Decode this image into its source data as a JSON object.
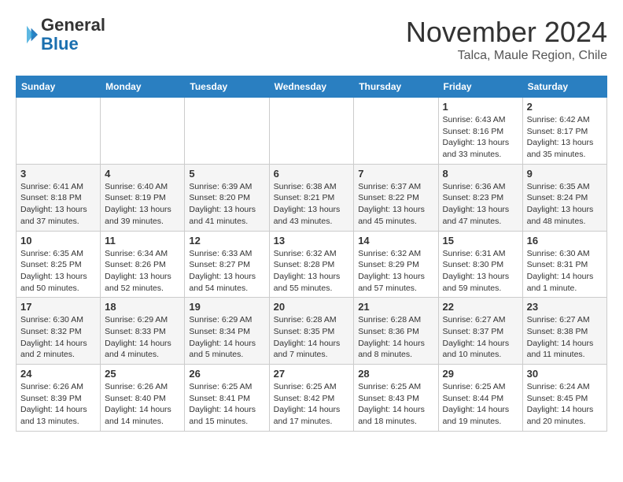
{
  "header": {
    "logo_general": "General",
    "logo_blue": "Blue",
    "month_title": "November 2024",
    "location": "Talca, Maule Region, Chile"
  },
  "weekdays": [
    "Sunday",
    "Monday",
    "Tuesday",
    "Wednesday",
    "Thursday",
    "Friday",
    "Saturday"
  ],
  "weeks": [
    [
      {
        "day": "",
        "info": ""
      },
      {
        "day": "",
        "info": ""
      },
      {
        "day": "",
        "info": ""
      },
      {
        "day": "",
        "info": ""
      },
      {
        "day": "",
        "info": ""
      },
      {
        "day": "1",
        "info": "Sunrise: 6:43 AM\nSunset: 8:16 PM\nDaylight: 13 hours and 33 minutes."
      },
      {
        "day": "2",
        "info": "Sunrise: 6:42 AM\nSunset: 8:17 PM\nDaylight: 13 hours and 35 minutes."
      }
    ],
    [
      {
        "day": "3",
        "info": "Sunrise: 6:41 AM\nSunset: 8:18 PM\nDaylight: 13 hours and 37 minutes."
      },
      {
        "day": "4",
        "info": "Sunrise: 6:40 AM\nSunset: 8:19 PM\nDaylight: 13 hours and 39 minutes."
      },
      {
        "day": "5",
        "info": "Sunrise: 6:39 AM\nSunset: 8:20 PM\nDaylight: 13 hours and 41 minutes."
      },
      {
        "day": "6",
        "info": "Sunrise: 6:38 AM\nSunset: 8:21 PM\nDaylight: 13 hours and 43 minutes."
      },
      {
        "day": "7",
        "info": "Sunrise: 6:37 AM\nSunset: 8:22 PM\nDaylight: 13 hours and 45 minutes."
      },
      {
        "day": "8",
        "info": "Sunrise: 6:36 AM\nSunset: 8:23 PM\nDaylight: 13 hours and 47 minutes."
      },
      {
        "day": "9",
        "info": "Sunrise: 6:35 AM\nSunset: 8:24 PM\nDaylight: 13 hours and 48 minutes."
      }
    ],
    [
      {
        "day": "10",
        "info": "Sunrise: 6:35 AM\nSunset: 8:25 PM\nDaylight: 13 hours and 50 minutes."
      },
      {
        "day": "11",
        "info": "Sunrise: 6:34 AM\nSunset: 8:26 PM\nDaylight: 13 hours and 52 minutes."
      },
      {
        "day": "12",
        "info": "Sunrise: 6:33 AM\nSunset: 8:27 PM\nDaylight: 13 hours and 54 minutes."
      },
      {
        "day": "13",
        "info": "Sunrise: 6:32 AM\nSunset: 8:28 PM\nDaylight: 13 hours and 55 minutes."
      },
      {
        "day": "14",
        "info": "Sunrise: 6:32 AM\nSunset: 8:29 PM\nDaylight: 13 hours and 57 minutes."
      },
      {
        "day": "15",
        "info": "Sunrise: 6:31 AM\nSunset: 8:30 PM\nDaylight: 13 hours and 59 minutes."
      },
      {
        "day": "16",
        "info": "Sunrise: 6:30 AM\nSunset: 8:31 PM\nDaylight: 14 hours and 1 minute."
      }
    ],
    [
      {
        "day": "17",
        "info": "Sunrise: 6:30 AM\nSunset: 8:32 PM\nDaylight: 14 hours and 2 minutes."
      },
      {
        "day": "18",
        "info": "Sunrise: 6:29 AM\nSunset: 8:33 PM\nDaylight: 14 hours and 4 minutes."
      },
      {
        "day": "19",
        "info": "Sunrise: 6:29 AM\nSunset: 8:34 PM\nDaylight: 14 hours and 5 minutes."
      },
      {
        "day": "20",
        "info": "Sunrise: 6:28 AM\nSunset: 8:35 PM\nDaylight: 14 hours and 7 minutes."
      },
      {
        "day": "21",
        "info": "Sunrise: 6:28 AM\nSunset: 8:36 PM\nDaylight: 14 hours and 8 minutes."
      },
      {
        "day": "22",
        "info": "Sunrise: 6:27 AM\nSunset: 8:37 PM\nDaylight: 14 hours and 10 minutes."
      },
      {
        "day": "23",
        "info": "Sunrise: 6:27 AM\nSunset: 8:38 PM\nDaylight: 14 hours and 11 minutes."
      }
    ],
    [
      {
        "day": "24",
        "info": "Sunrise: 6:26 AM\nSunset: 8:39 PM\nDaylight: 14 hours and 13 minutes."
      },
      {
        "day": "25",
        "info": "Sunrise: 6:26 AM\nSunset: 8:40 PM\nDaylight: 14 hours and 14 minutes."
      },
      {
        "day": "26",
        "info": "Sunrise: 6:25 AM\nSunset: 8:41 PM\nDaylight: 14 hours and 15 minutes."
      },
      {
        "day": "27",
        "info": "Sunrise: 6:25 AM\nSunset: 8:42 PM\nDaylight: 14 hours and 17 minutes."
      },
      {
        "day": "28",
        "info": "Sunrise: 6:25 AM\nSunset: 8:43 PM\nDaylight: 14 hours and 18 minutes."
      },
      {
        "day": "29",
        "info": "Sunrise: 6:25 AM\nSunset: 8:44 PM\nDaylight: 14 hours and 19 minutes."
      },
      {
        "day": "30",
        "info": "Sunrise: 6:24 AM\nSunset: 8:45 PM\nDaylight: 14 hours and 20 minutes."
      }
    ]
  ]
}
